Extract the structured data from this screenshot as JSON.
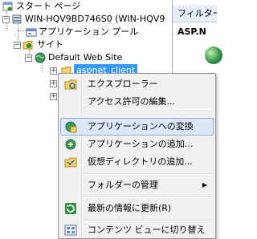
{
  "tree": {
    "items": [
      {
        "label": "スタート ページ"
      },
      {
        "label": "WIN-HQV9BD746S0 (WIN-HQV9"
      },
      {
        "label": "アプリケーション プール"
      },
      {
        "label": "サイト"
      },
      {
        "label": "Default Web Site"
      },
      {
        "label": "aspnet_client"
      }
    ]
  },
  "right_pane": {
    "header": "フィルター",
    "subheader": "ASP.N"
  },
  "context_menu": {
    "items": [
      {
        "label": "エクスプローラー"
      },
      {
        "label": "アクセス許可の編集..."
      },
      {
        "label": "アプリケーションへの変換"
      },
      {
        "label": "アプリケーションの追加..."
      },
      {
        "label": "仮想ディレクトリの追加..."
      },
      {
        "label": "フォルダーの管理"
      },
      {
        "label": "最新の情報に更新(R)"
      },
      {
        "label": "コンテンツ ビューに切り替え"
      }
    ],
    "submenu_arrow": "▶",
    "hovered_item": "アプリケーションへの変換"
  },
  "icons": {
    "start_page": "start-page-icon",
    "server": "server-icon",
    "app_pool": "app-pool-icon",
    "sites": "sites-folder-icon",
    "web_site": "globe-icon",
    "folder": "folder-icon"
  }
}
